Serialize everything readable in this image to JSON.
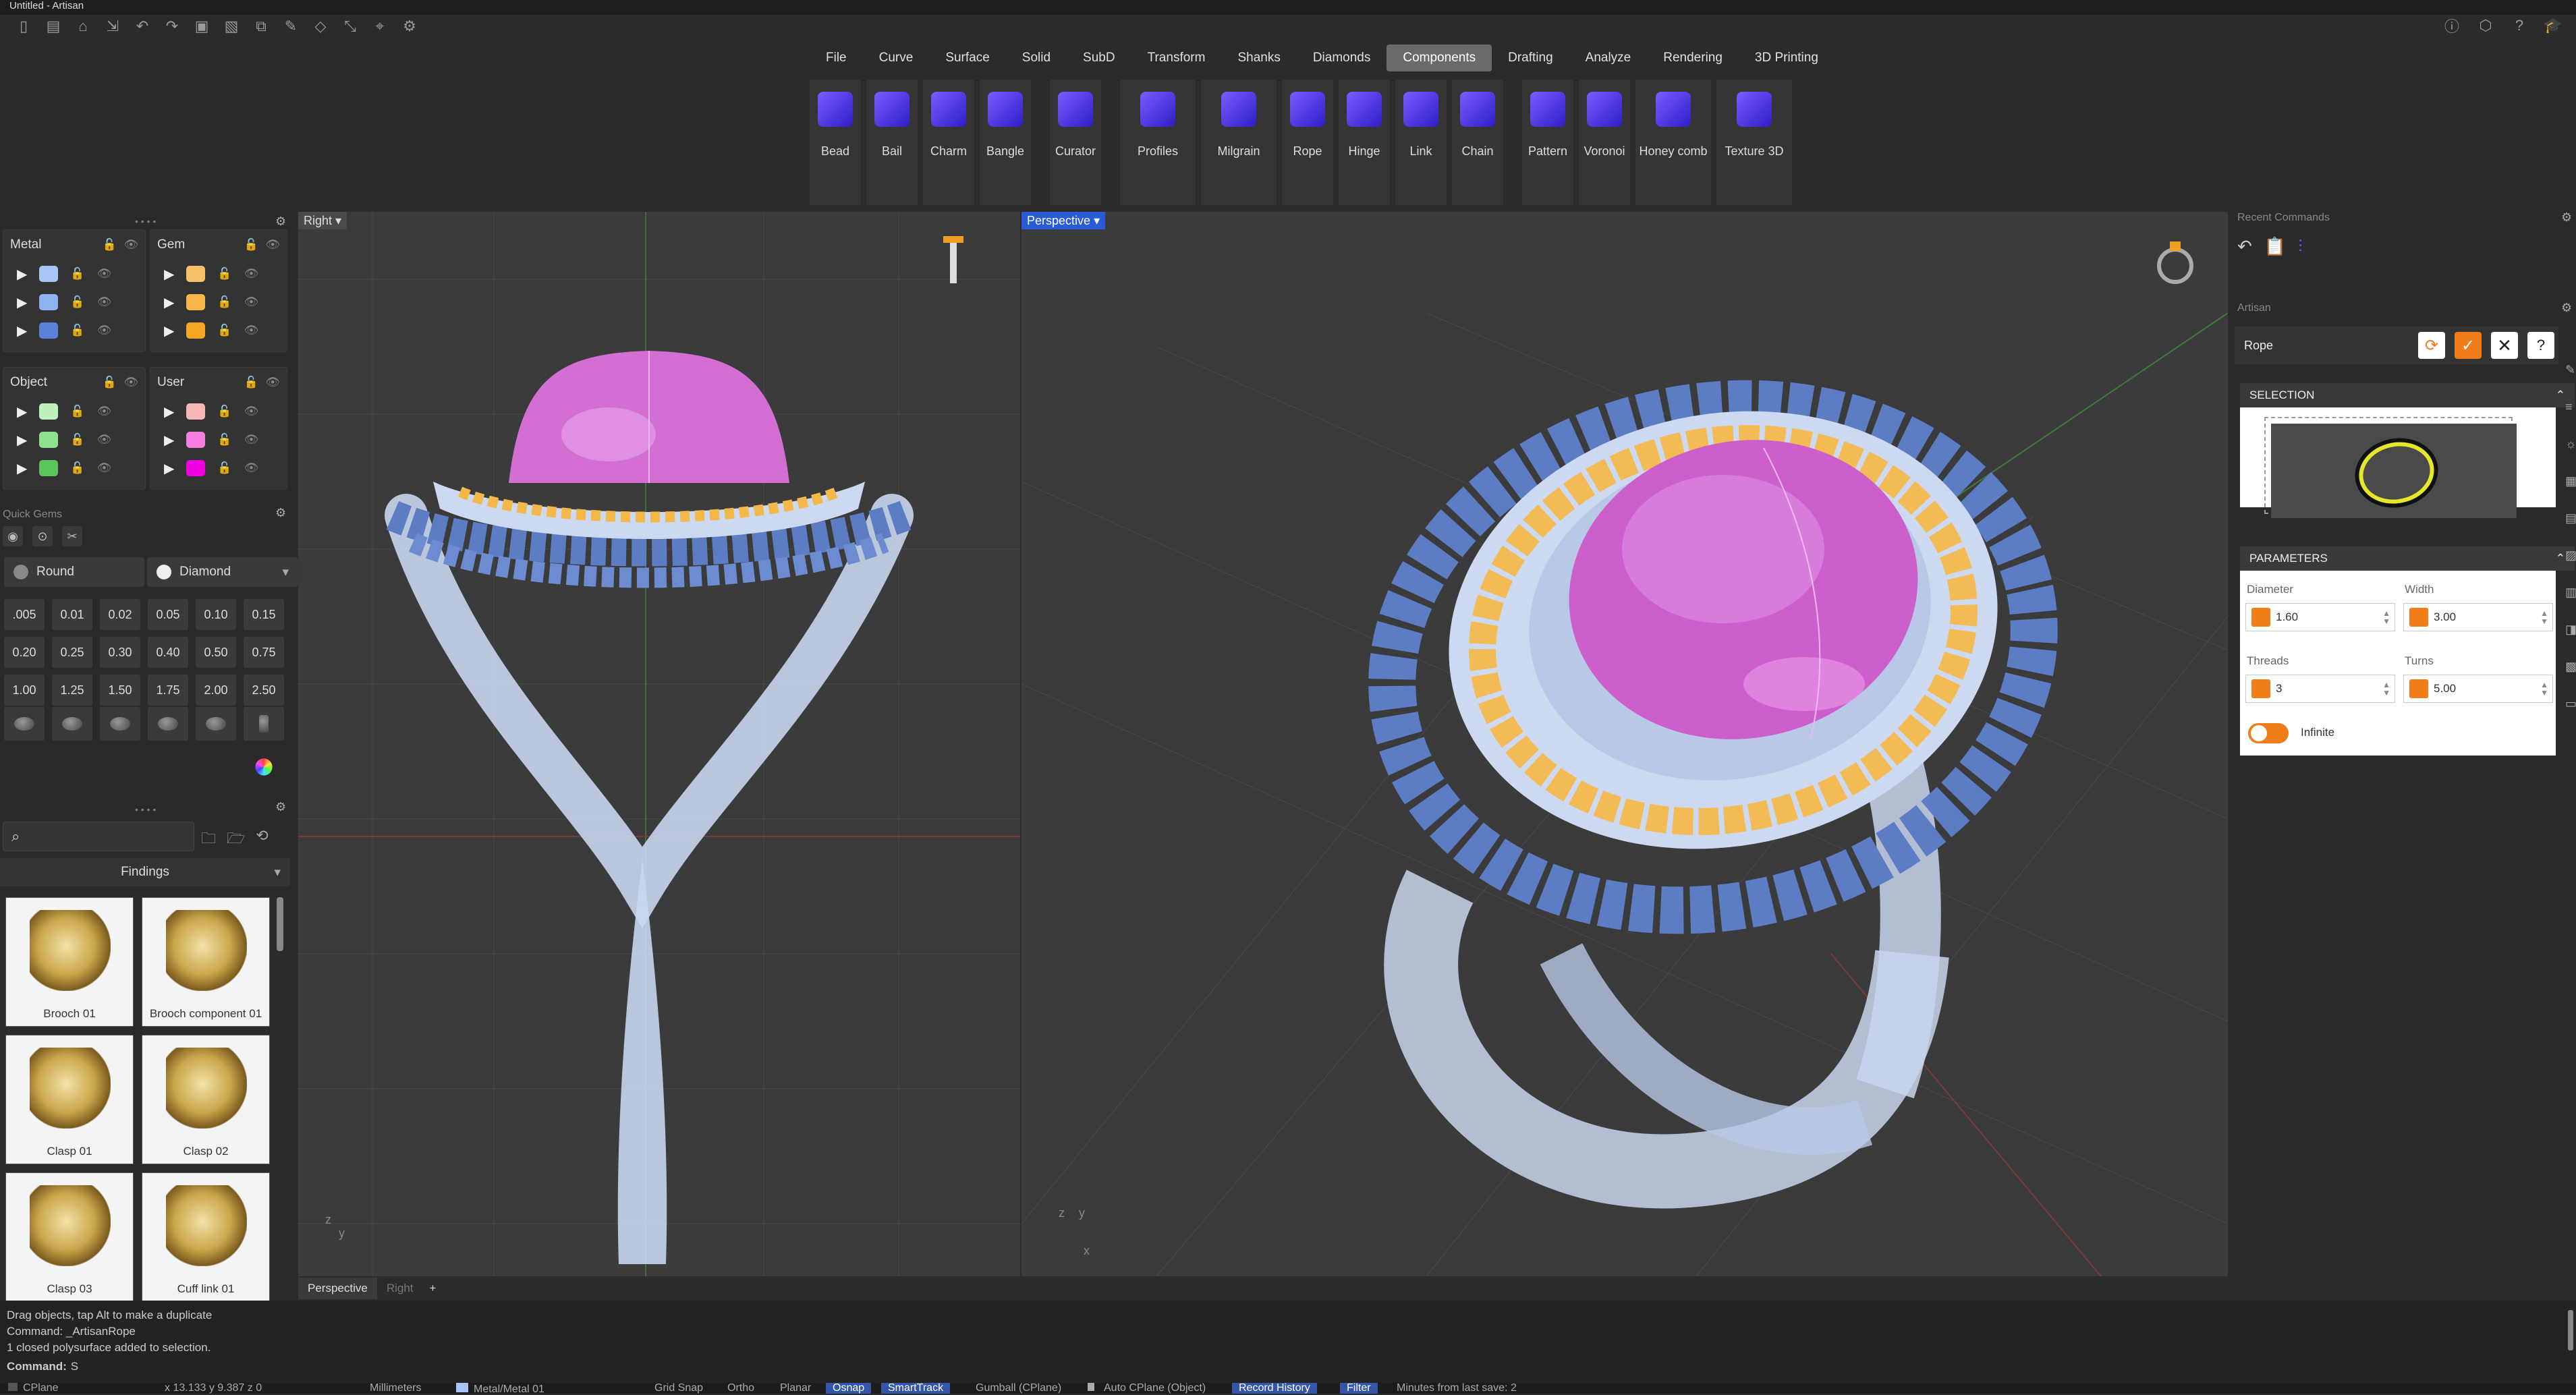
{
  "window": {
    "title": "Untitled - Artisan"
  },
  "menu": {
    "items": [
      "File",
      "Curve",
      "Surface",
      "Solid",
      "SubD",
      "Transform",
      "Shanks",
      "Diamonds",
      "Components",
      "Drafting",
      "Analyze",
      "Rendering",
      "3D Printing"
    ],
    "active": "Components"
  },
  "ribbon": {
    "tools": [
      "Bead",
      "Bail",
      "Charm",
      "Bangle",
      "Curator",
      "Profiles",
      "Milgrain",
      "Rope",
      "Hinge",
      "Link",
      "Chain",
      "Pattern",
      "Voronoi",
      "Honey comb",
      "Texture 3D"
    ]
  },
  "layers": {
    "metal": {
      "label": "Metal",
      "colors": [
        "#a8c4f5",
        "#8fb2f0",
        "#5a80d8"
      ]
    },
    "gem": {
      "label": "Gem",
      "colors": [
        "#f7c16a",
        "#f6b84a",
        "#f5a623"
      ]
    },
    "object": {
      "label": "Object",
      "colors": [
        "#bdf0bd",
        "#8de28d",
        "#5cc45c"
      ]
    },
    "user": {
      "label": "User",
      "colors": [
        "#f7b8b8",
        "#f57fe0",
        "#f000e0"
      ]
    }
  },
  "quick_gems": {
    "title": "Quick Gems",
    "cut": "Round",
    "material": "Diamond",
    "sizes": [
      ".005",
      "0.01",
      "0.02",
      "0.05",
      "0.10",
      "0.15",
      "0.20",
      "0.25",
      "0.30",
      "0.40",
      "0.50",
      "0.75",
      "1.00",
      "1.25",
      "1.50",
      "1.75",
      "2.00",
      "2.50"
    ]
  },
  "library": {
    "category": "Findings",
    "items": [
      "Brooch 01",
      "Brooch component 01",
      "Clasp 01",
      "Clasp 02",
      "Clasp 03",
      "Cuff link 01"
    ]
  },
  "viewports": {
    "right_label": "Right",
    "perspective_label": "Perspective",
    "tabs": [
      "Perspective",
      "Right"
    ]
  },
  "right_panel": {
    "recent_title": "Recent Commands",
    "artisan_title": "Artisan",
    "command_name": "Rope",
    "selection_title": "SELECTION",
    "parameters_title": "PARAMETERS",
    "params": {
      "diameter_label": "Diameter",
      "diameter_value": "1.60",
      "width_label": "Width",
      "width_value": "3.00",
      "threads_label": "Threads",
      "threads_value": "3",
      "turns_label": "Turns",
      "turns_value": "5.00",
      "infinite_label": "Infinite"
    }
  },
  "command_history": {
    "lines": [
      "Drag objects, tap Alt to make a duplicate",
      "Command: _ArtisanRope",
      "1 closed polysurface added to selection."
    ],
    "prompt_label": "Command:",
    "prompt_value": "S"
  },
  "status": {
    "cplane": "CPlane",
    "coords": "x 13.133  y 9.387  z 0",
    "units": "Millimeters",
    "layer": "Metal/Metal 01",
    "grid_snap": "Grid Snap",
    "ortho": "Ortho",
    "planar": "Planar",
    "osnap": "Osnap",
    "smarttrack": "SmartTrack",
    "gumball": "Gumball (CPlane)",
    "auto_cplane": "Auto CPlane (Object)",
    "record_history": "Record History",
    "filter": "Filter",
    "minutes": "Minutes from last save: 2"
  },
  "colors": {
    "accent": "#f07d1a",
    "active_tab": "#2a5bd7",
    "metal": "#8fb2f0",
    "gem_purple": "#d85fd2",
    "gem_yellow": "#f5b040"
  }
}
